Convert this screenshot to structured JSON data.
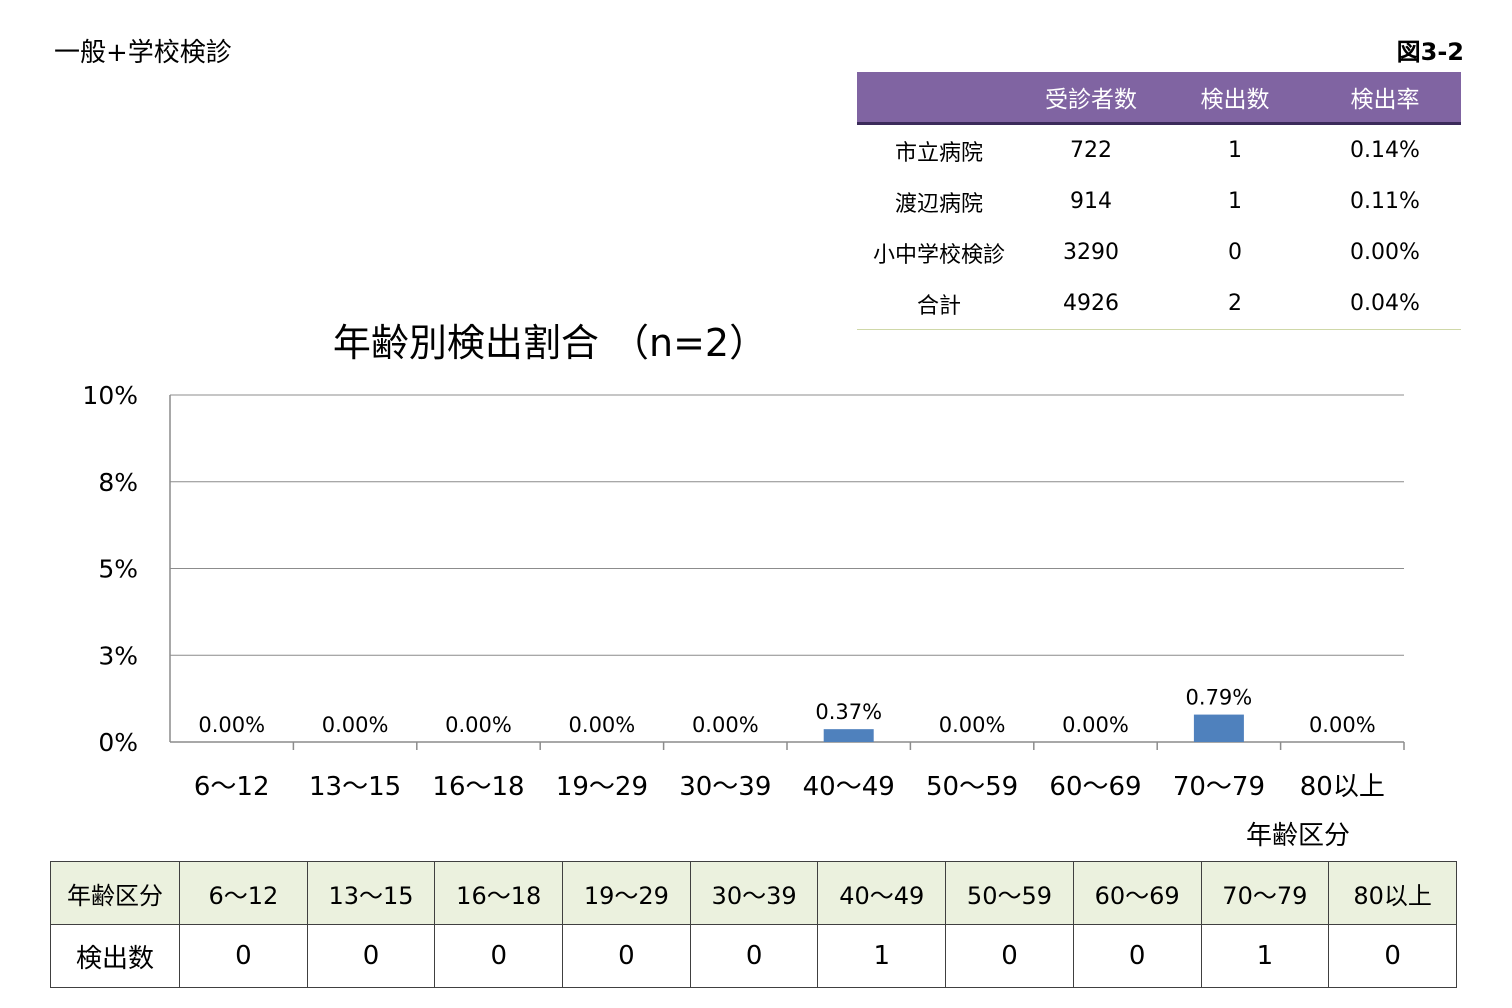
{
  "header": {
    "left_label": "一般+学校検診",
    "figure_no": "図3-2"
  },
  "summary": {
    "columns": [
      "",
      "受診者数",
      "検出数",
      "検出率"
    ],
    "rows": [
      [
        "市立病院",
        "722",
        "1",
        "0.14%"
      ],
      [
        "渡辺病院",
        "914",
        "1",
        "0.11%"
      ],
      [
        "小中学校検診",
        "3290",
        "0",
        "0.00%"
      ],
      [
        "合計",
        "4926",
        "2",
        "0.04%"
      ]
    ],
    "header_color": "#8064a2"
  },
  "chart_data": {
    "type": "bar",
    "title": "年齢別検出割合 （n=2）",
    "xlabel": "年齢区分",
    "ylabel": "",
    "categories": [
      "6〜12",
      "13〜15",
      "16〜18",
      "19〜29",
      "30〜39",
      "40〜49",
      "50〜59",
      "60〜69",
      "70〜79",
      "80以上"
    ],
    "values": [
      0.0,
      0.0,
      0.0,
      0.0,
      0.0,
      0.37,
      0.0,
      0.0,
      0.79,
      0.0
    ],
    "data_labels": [
      "0.00%",
      "0.00%",
      "0.00%",
      "0.00%",
      "0.00%",
      "0.37%",
      "0.00%",
      "0.00%",
      "0.79%",
      "0.00%"
    ],
    "ylim": [
      0,
      10
    ],
    "yticks": [
      0,
      2.5,
      5,
      7.5,
      10
    ],
    "ytick_labels": [
      "0%",
      "3%",
      "5%",
      "8%",
      "10%"
    ],
    "grid": true,
    "bar_color": "#4f81bd"
  },
  "age_table": {
    "header_label": "年齢区分",
    "row_label": "検出数",
    "categories": [
      "6〜12",
      "13〜15",
      "16〜18",
      "19〜29",
      "30〜39",
      "40〜49",
      "50〜59",
      "60〜69",
      "70〜79",
      "80以上"
    ],
    "counts": [
      "0",
      "0",
      "0",
      "0",
      "0",
      "1",
      "0",
      "0",
      "1",
      "0"
    ],
    "header_bg": "#ebf1de"
  }
}
